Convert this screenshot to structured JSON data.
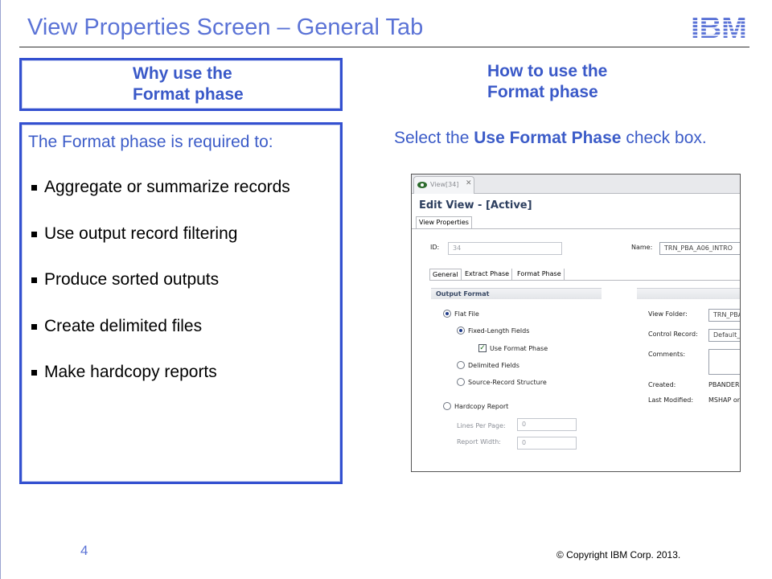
{
  "slide": {
    "title": "View Properties Screen – General Tab",
    "logo_text": "IBM",
    "page_number": "4",
    "copyright": "© Copyright  IBM Corp. 2013.",
    "accent_color": "#3350d0"
  },
  "why": {
    "line1": "Why use the",
    "line2": "Format phase"
  },
  "how": {
    "line1": "How to use the",
    "line2": "Format phase"
  },
  "requirements": {
    "intro": "The Format phase is required to:",
    "items": [
      "Aggregate or summarize records",
      "Use output record filtering",
      "Produce sorted outputs",
      "Create delimited files",
      "Make hardcopy reports"
    ]
  },
  "instruction": {
    "prefix": "Select the ",
    "bold": "Use Format Phase",
    "suffix": " check box."
  },
  "screenshot": {
    "tab_label": "View[34]",
    "tab_close": "✕",
    "editor_title": "Edit View - [Active]",
    "properties_tab": "View Properties",
    "id_label": "ID:",
    "id_value": "34",
    "name_label": "Name:",
    "name_value": "TRN_PBA_A06_INTRO",
    "subtabs": [
      "General",
      "Extract Phase",
      "Format Phase"
    ],
    "output_format_heading": "Output Format",
    "options": {
      "flat_file": "Flat File",
      "fixed_length": "Fixed-Length Fields",
      "use_format_phase": "Use Format Phase",
      "delimited": "Delimited Fields",
      "source_record": "Source-Record Structure",
      "hardcopy": "Hardcopy Report",
      "lines_per_page": "Lines Per Page:",
      "lines_per_page_value": "0",
      "report_width": "Report Width:",
      "report_width_value": "0"
    },
    "right": {
      "view_folder_label": "View Folder:",
      "view_folder_value": "TRN_PBA",
      "control_record_label": "Control Record:",
      "control_record_value": "Default_",
      "comments_label": "Comments:",
      "created_label": "Created:",
      "created_value": "PBANDER",
      "modified_label": "Last Modified:",
      "modified_value": "MSHAP or"
    }
  }
}
